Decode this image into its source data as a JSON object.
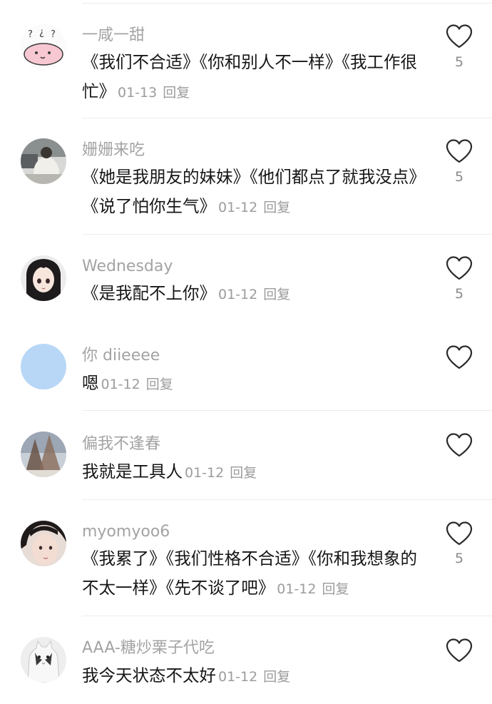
{
  "comments": [
    {
      "username": "一咸一甜",
      "text": "《我们不合适》《你和别人不一样》《我工作很忙》",
      "date": "01-13",
      "reply_label": "回复",
      "likes": "5",
      "avatar_icon": "cartoon-avatar"
    },
    {
      "username": "姗姗来吃",
      "text": "《她是我朋友的妹妹》《他们都点了就我没点》《说了怕你生气》",
      "date": "01-12",
      "reply_label": "回复",
      "likes": "5",
      "avatar_icon": "photo-avatar"
    },
    {
      "username": "Wednesday",
      "text": "《是我配不上你》",
      "date": "01-12",
      "reply_label": "回复",
      "likes": "5",
      "avatar_icon": "anime-girl-avatar"
    },
    {
      "username": "你 diieeee",
      "text": "嗯",
      "date": "01-12",
      "reply_label": "回复",
      "likes": "",
      "avatar_icon": "blue-circle-avatar"
    },
    {
      "username": "偏我不逢春",
      "text": "我就是工具人",
      "date": "01-12",
      "reply_label": "回复",
      "likes": "",
      "avatar_icon": "tree-photo-avatar"
    },
    {
      "username": "myomyoo6",
      "text": "《我累了》《我们性格不合适》《你和我想象的不太一样》《先不谈了吧》",
      "date": "01-12",
      "reply_label": "回复",
      "likes": "5",
      "avatar_icon": "girl-photo-avatar"
    },
    {
      "username": "AAA-糖炒栗子代吃",
      "text": "我今天状态不太好",
      "date": "01-12",
      "reply_label": "回复",
      "likes": "",
      "avatar_icon": "cat-avatar"
    }
  ],
  "colors": {
    "username": "#a3a3a3",
    "text": "#161616",
    "meta": "#9c9c9c",
    "divider": "#ececec",
    "heart_outline": "#2a2a2a"
  }
}
